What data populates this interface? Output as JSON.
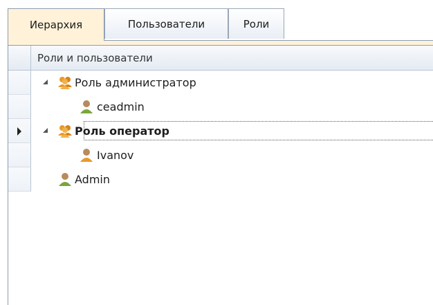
{
  "tabs": [
    {
      "label": "Иерархия",
      "active": true
    },
    {
      "label": "Пользователи",
      "active": false
    },
    {
      "label": "Роли",
      "active": false
    }
  ],
  "grid": {
    "column_header": "Роли и пользователи",
    "rows": [
      {
        "label": "Роль администратор",
        "type": "role",
        "level": 0,
        "expanded": true
      },
      {
        "label": "ceadmin",
        "type": "user",
        "level": 1
      },
      {
        "label": "Роль оператор",
        "type": "role",
        "level": 0,
        "expanded": true,
        "selected": true
      },
      {
        "label": "Ivanov",
        "type": "user",
        "level": 1
      },
      {
        "label": "Admin",
        "type": "user",
        "level": 0
      }
    ]
  },
  "colors": {
    "active_tab": "#fff2d9",
    "border": "#8b9bb0",
    "role_icon": "#e89a2b",
    "user_icon": "#7aa63a"
  },
  "icons": {
    "role": "group-icon",
    "user": "user-icon"
  }
}
